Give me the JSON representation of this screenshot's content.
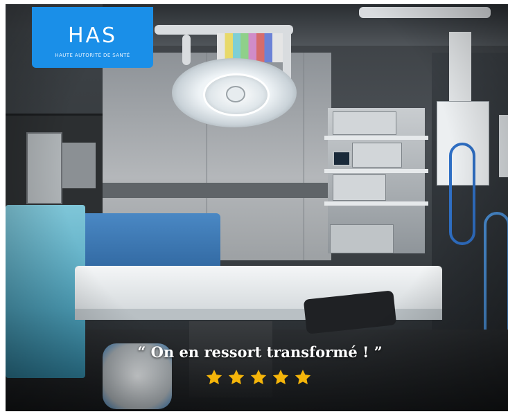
{
  "logo": {
    "mark": "HAS",
    "subtitle": "HAUTE AUTORITÉ DE SANTÉ",
    "color": "#1a8fe8"
  },
  "caption": {
    "quote": "“ On en ressort transformé ! ”"
  },
  "rating": {
    "value": 5,
    "max": 5,
    "color": "#f5b50a"
  }
}
